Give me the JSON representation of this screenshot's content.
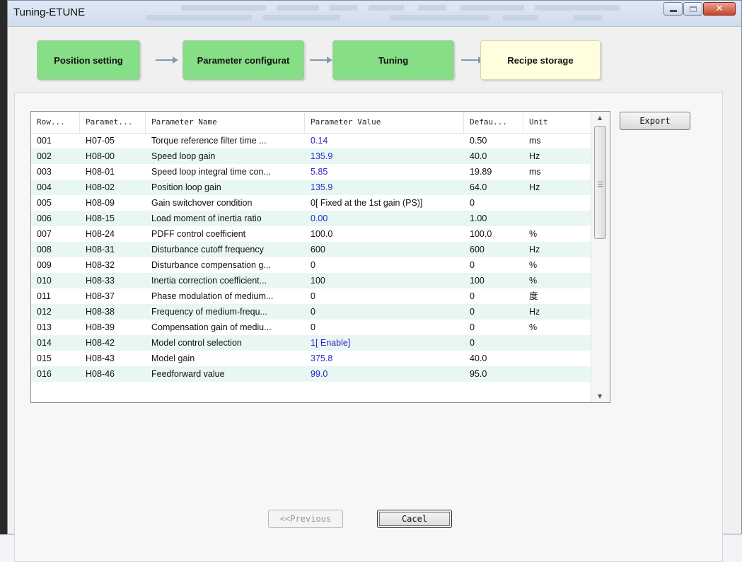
{
  "window": {
    "title": "Tuning-ETUNE"
  },
  "steps": [
    {
      "label": "Position setting",
      "state": "done"
    },
    {
      "label": "Parameter configurat",
      "state": "done"
    },
    {
      "label": "Tuning",
      "state": "done"
    },
    {
      "label": "Recipe storage",
      "state": "current"
    }
  ],
  "table": {
    "columns": [
      "Row...",
      "Paramet...",
      "Parameter Name",
      "Parameter Value",
      "Defau...",
      "Unit"
    ],
    "rows": [
      [
        "001",
        "H07-05",
        "Torque reference filter time ...",
        "0.14",
        "0.50",
        "ms"
      ],
      [
        "002",
        "H08-00",
        "Speed loop gain",
        "135.9",
        "40.0",
        "Hz"
      ],
      [
        "003",
        "H08-01",
        "Speed loop integral time con...",
        "5.85",
        "19.89",
        "ms"
      ],
      [
        "004",
        "H08-02",
        "Position loop gain",
        "135.9",
        "64.0",
        "Hz"
      ],
      [
        "005",
        "H08-09",
        "Gain switchover condition",
        "0[ Fixed at the 1st gain (PS)]",
        "0",
        ""
      ],
      [
        "006",
        "H08-15",
        "Load moment of inertia ratio",
        "0.00",
        "1.00",
        ""
      ],
      [
        "007",
        "H08-24",
        "PDFF control coefficient",
        "100.0",
        "100.0",
        "%"
      ],
      [
        "008",
        "H08-31",
        "Disturbance cutoff frequency",
        "600",
        "600",
        "Hz"
      ],
      [
        "009",
        "H08-32",
        "Disturbance compensation g...",
        "0",
        "0",
        "%"
      ],
      [
        "010",
        "H08-33",
        "Inertia correction coefficient...",
        "100",
        "100",
        "%"
      ],
      [
        "011",
        "H08-37",
        "Phase modulation of medium...",
        "0",
        "0",
        "度"
      ],
      [
        "012",
        "H08-38",
        "Frequency of medium-frequ...",
        "0",
        "0",
        "Hz"
      ],
      [
        "013",
        "H08-39",
        "Compensation gain of mediu...",
        "0",
        "0",
        "%"
      ],
      [
        "014",
        "H08-42",
        "Model control selection",
        "1[ Enable]",
        "0",
        ""
      ],
      [
        "015",
        "H08-43",
        "Model gain",
        "375.8",
        "40.0",
        ""
      ],
      [
        "016",
        "H08-46",
        "Feedforward value",
        "99.0",
        "95.0",
        ""
      ]
    ],
    "modified_rows": [
      0,
      1,
      2,
      3,
      5,
      13,
      14,
      15
    ]
  },
  "buttons": {
    "export": "Export",
    "previous": "<<Previous",
    "cancel": "Cacel"
  },
  "colors": {
    "step_done": "#86de86",
    "step_current": "#ffffdf",
    "modified_value": "#2828c8",
    "row_alt": "#e9f7f3"
  }
}
